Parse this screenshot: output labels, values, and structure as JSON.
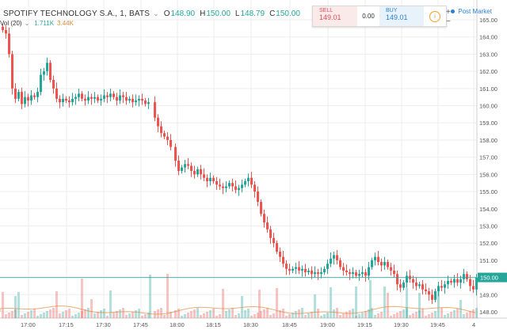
{
  "header": {
    "symbol": "SPOTIFY TECHNOLOGY S.A., 1, BATS",
    "settings_icon": "chevron-icon",
    "o_label": "O",
    "o_value": "148.90",
    "h_label": "H",
    "h_value": "150.00",
    "l_label": "L",
    "l_value": "148.79",
    "c_label": "C",
    "c_value": "150.00"
  },
  "volume": {
    "label": "Vol (20)",
    "value1": "1.711K",
    "value2": "3.44K"
  },
  "trade": {
    "sell_label": "SELL",
    "sell_value": "149.01",
    "spread": "0.00",
    "buy_label": "BUY",
    "buy_value": "149.01",
    "info_icon": "info-icon"
  },
  "zoom": {
    "plus": "+",
    "minus": "−"
  },
  "post_market": "Post Market",
  "chart_data": {
    "type": "candlestick",
    "current_price_label": "150.00",
    "y_ticks": [
      "165.00",
      "164.00",
      "163.00",
      "162.00",
      "161.00",
      "160.00",
      "159.00",
      "158.00",
      "157.00",
      "156.00",
      "155.00",
      "154.00",
      "153.00",
      "152.00",
      "151.00",
      "150.00",
      "149.00",
      "148.00"
    ],
    "x_ticks": [
      "17:00",
      "17:15",
      "17:30",
      "17:45",
      "18:00",
      "18:15",
      "18:30",
      "18:45",
      "19:00",
      "19:15",
      "19:30",
      "19:45",
      "4"
    ],
    "up_color": "#26a69a",
    "down_color": "#ef5350",
    "price_line_color": "#26a69a"
  }
}
